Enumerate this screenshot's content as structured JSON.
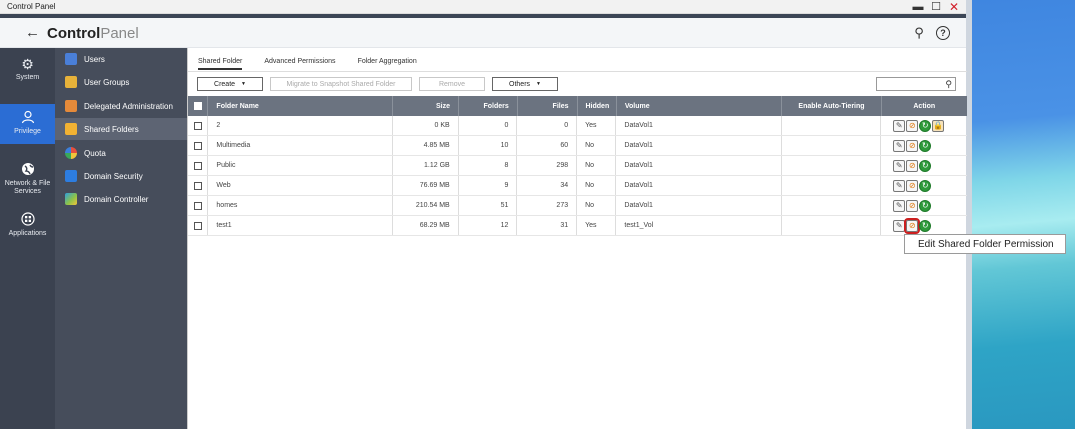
{
  "window": {
    "title": "Control Panel"
  },
  "header": {
    "title_bold": "Control",
    "title_light": "Panel"
  },
  "leftnav": [
    {
      "label": "System",
      "icon": "gear-icon"
    },
    {
      "label": "Privilege",
      "icon": "user-icon",
      "active": true
    },
    {
      "label": "Network & File Services",
      "icon": "globe-icon"
    },
    {
      "label": "Applications",
      "icon": "apps-icon"
    }
  ],
  "subnav": [
    {
      "label": "Users",
      "icon": "user-icon"
    },
    {
      "label": "User Groups",
      "icon": "user-group-icon"
    },
    {
      "label": "Delegated Administration",
      "icon": "delegated-admin-icon"
    },
    {
      "label": "Shared Folders",
      "icon": "shared-folder-icon",
      "active": true
    },
    {
      "label": "Quota",
      "icon": "quota-icon"
    },
    {
      "label": "Domain Security",
      "icon": "domain-security-icon"
    },
    {
      "label": "Domain Controller",
      "icon": "domain-controller-icon"
    }
  ],
  "tabs": [
    "Shared Folder",
    "Advanced Permissions",
    "Folder Aggregation"
  ],
  "toolbar": {
    "create": "Create",
    "migrate": "Migrate to Snapshot Shared Folder",
    "remove": "Remove",
    "others": "Others"
  },
  "table": {
    "headers": {
      "name": "Folder Name",
      "size": "Size",
      "folders": "Folders",
      "files": "Files",
      "hidden": "Hidden",
      "volume": "Volume",
      "tiering": "Enable Auto-Tiering",
      "action": "Action"
    },
    "rows": [
      {
        "name": "2",
        "size": "0 KB",
        "folders": "0",
        "files": "0",
        "hidden": "Yes",
        "volume": "DataVol1",
        "tiering": ""
      },
      {
        "name": "Multimedia",
        "size": "4.85 MB",
        "folders": "10",
        "files": "60",
        "hidden": "No",
        "volume": "DataVol1",
        "tiering": ""
      },
      {
        "name": "Public",
        "size": "1.12 GB",
        "folders": "8",
        "files": "298",
        "hidden": "No",
        "volume": "DataVol1",
        "tiering": ""
      },
      {
        "name": "Web",
        "size": "76.69 MB",
        "folders": "9",
        "files": "34",
        "hidden": "No",
        "volume": "DataVol1",
        "tiering": ""
      },
      {
        "name": "homes",
        "size": "210.54 MB",
        "folders": "51",
        "files": "273",
        "hidden": "No",
        "volume": "DataVol1",
        "tiering": ""
      },
      {
        "name": "test1",
        "size": "68.29 MB",
        "folders": "12",
        "files": "31",
        "hidden": "Yes",
        "volume": "test1_Vol",
        "tiering": ""
      }
    ]
  },
  "tooltip": "Edit Shared Folder Permission",
  "colors": {
    "accent": "#2b6dd4",
    "nav_dark": "#3b4250",
    "subnav": "#464d5b",
    "header_row": "#6b7380",
    "highlight": "#cc1f1f"
  }
}
